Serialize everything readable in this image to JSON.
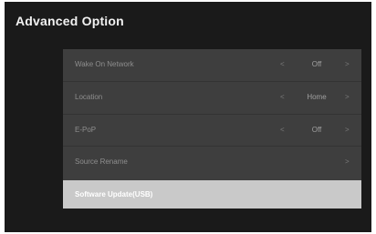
{
  "screen": {
    "title": "Advanced Option"
  },
  "menu": {
    "items": [
      {
        "label": "Wake On Network",
        "value": "Off",
        "left_arrow": "<",
        "right_arrow": ">"
      },
      {
        "label": "Location",
        "value": "Home",
        "left_arrow": "<",
        "right_arrow": ">"
      },
      {
        "label": "E-PoP",
        "value": "Off",
        "left_arrow": "<",
        "right_arrow": ">"
      },
      {
        "label": "Source Rename",
        "right_arrow": ">"
      },
      {
        "label": "Software Update(USB)"
      }
    ]
  },
  "colors": {
    "background": "#1a1a1a",
    "panel": "#3e3e3e",
    "highlight": "#c9c9c9"
  }
}
